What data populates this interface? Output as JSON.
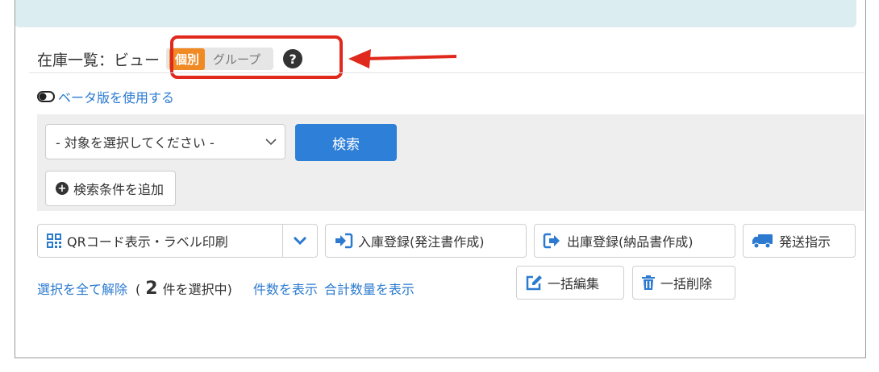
{
  "header": {
    "title": "在庫一覧：ビュー",
    "view_toggle": {
      "active": "個別",
      "inactive": "グループ"
    },
    "help_icon": "?"
  },
  "beta_link": "ベータ版を使用する",
  "search": {
    "select_value": "- 対象を選択してください -",
    "search_button": "検索",
    "add_condition": "検索条件を追加"
  },
  "toolbar": {
    "qr_label": "QRコード表示・ラベル印刷",
    "stock_in": "入庫登録(発注書作成)",
    "stock_out": "出庫登録(納品書作成)",
    "shipping": "発送指示",
    "bulk_edit": "一括編集",
    "bulk_delete": "一括削除"
  },
  "status": {
    "clear_selection": "選択を全て解除",
    "open_paren": "(",
    "selected_count": "2",
    "selected_suffix": "件を選択中)",
    "show_count": "件数を表示",
    "show_total": "合計数量を表示"
  },
  "colors": {
    "accent": "#2e7fd8",
    "highlight": "#e0291c",
    "active_segment": "#f08a24",
    "link": "#2b7ad0"
  }
}
